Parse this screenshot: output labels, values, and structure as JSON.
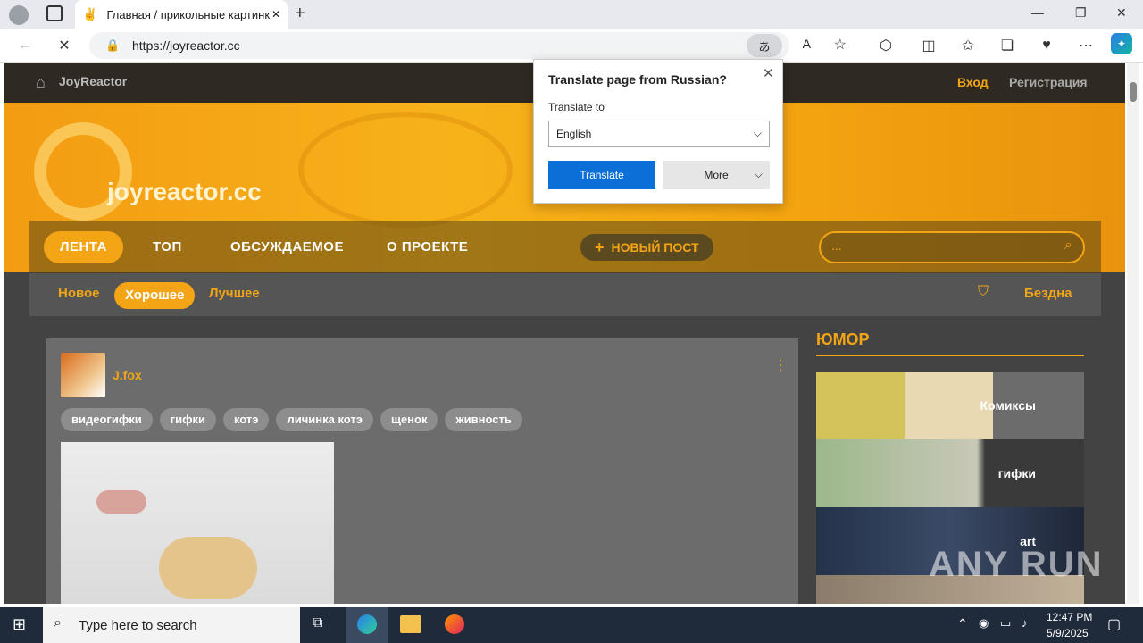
{
  "browser": {
    "tab_title": "Главная / прикольные картинк",
    "url": "https://joyreactor.cc",
    "window_buttons": {
      "minimize": "—",
      "maximize": "❐",
      "close": "✕"
    }
  },
  "site": {
    "brand": "JoyReactor",
    "logo_text": "joyreactor.cc",
    "login": "Вход",
    "register": "Регистрация",
    "nav": [
      "ЛЕНТА",
      "ТОП",
      "ОБСУЖДАЕМОЕ",
      "О ПРОЕКТЕ"
    ],
    "new_post": "НОВЫЙ ПОСТ",
    "search_placeholder": "...",
    "subnav": [
      "Новое",
      "Хорошее",
      "Лучшее"
    ],
    "abyss": "Бездна",
    "accent": "#f4a516"
  },
  "post": {
    "author": "J.fox",
    "tags": [
      "видеогифки",
      "гифки",
      "котэ",
      "личинка котэ",
      "щенок",
      "живность"
    ]
  },
  "sidebar": {
    "title": "ЮМОР",
    "tiles": [
      "Комиксы",
      "гифки",
      "art"
    ]
  },
  "translate_popup": {
    "title": "Translate page from Russian?",
    "translate_to_label": "Translate to",
    "language": "English",
    "translate_button": "Translate",
    "more_button": "More"
  },
  "taskbar": {
    "search_placeholder": "Type here to search",
    "time": "12:47 PM",
    "date": "5/9/2025"
  },
  "watermark": "ANY RUN"
}
